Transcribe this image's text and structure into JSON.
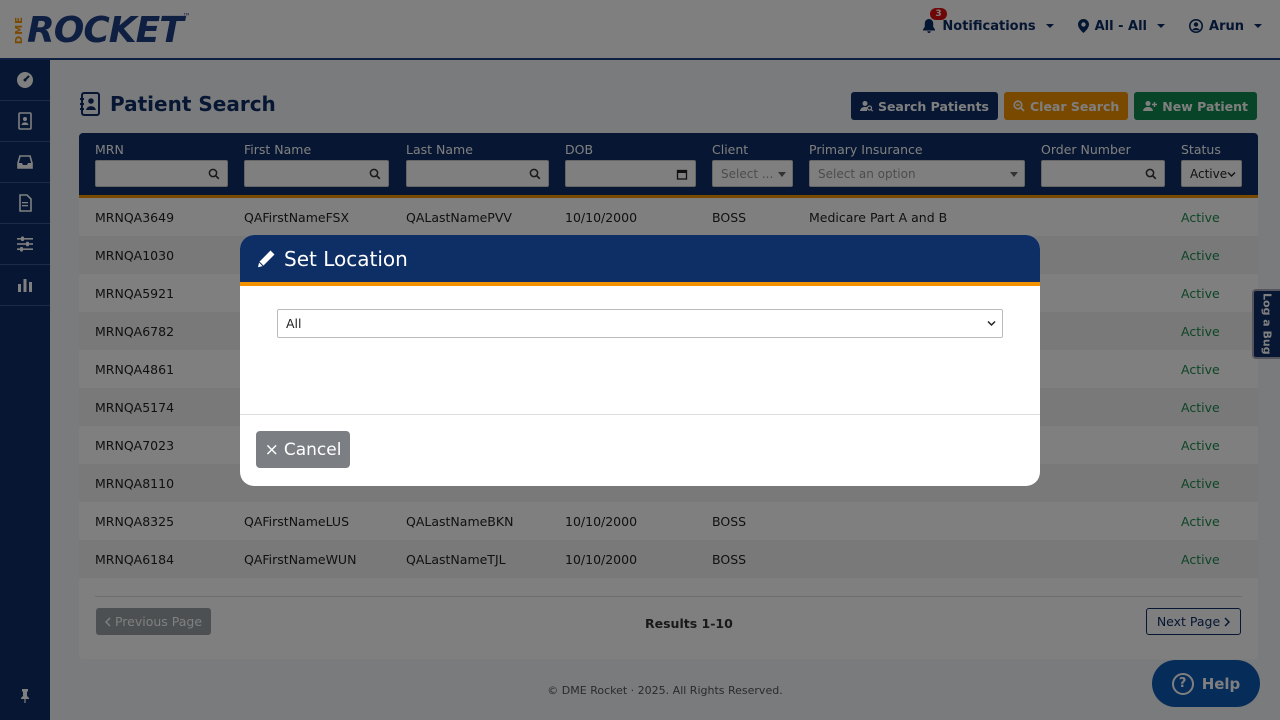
{
  "brand": {
    "prefix": "DME",
    "name": "ROCKET",
    "tm": "™"
  },
  "topnav": {
    "notifications_label": "Notifications",
    "notifications_count": "3",
    "location_label": "All - All",
    "user_label": "Arun"
  },
  "sidebar": {
    "items": [
      "dashboard-icon",
      "patients-icon",
      "inbox-icon",
      "documents-icon",
      "settings-sliders-icon",
      "reports-chart-icon"
    ]
  },
  "page": {
    "title": "Patient Search",
    "buttons": {
      "search": "Search Patients",
      "clear": "Clear Search",
      "new": "New Patient"
    }
  },
  "table": {
    "headers": [
      "MRN",
      "First Name",
      "Last Name",
      "DOB",
      "Client",
      "Primary Insurance",
      "Order Number",
      "Status"
    ],
    "filters": {
      "client_placeholder": "Select ...",
      "insurance_placeholder": "Select an option",
      "status_value": "Active"
    },
    "rows": [
      {
        "mrn": "MRNQA3649",
        "first": "QAFirstNameFSX",
        "last": "QALastNamePVV",
        "dob": "10/10/2000",
        "client": "BOSS",
        "insurance": "Medicare Part A and B",
        "status": "Active"
      },
      {
        "mrn": "MRNQA1030",
        "first": "",
        "last": "",
        "dob": "",
        "client": "",
        "insurance": "",
        "status": "Active"
      },
      {
        "mrn": "MRNQA5921",
        "first": "",
        "last": "",
        "dob": "",
        "client": "",
        "insurance": "",
        "status": "Active"
      },
      {
        "mrn": "MRNQA6782",
        "first": "",
        "last": "",
        "dob": "",
        "client": "",
        "insurance": "",
        "status": "Active"
      },
      {
        "mrn": "MRNQA4861",
        "first": "",
        "last": "",
        "dob": "",
        "client": "",
        "insurance": "",
        "status": "Active"
      },
      {
        "mrn": "MRNQA5174",
        "first": "",
        "last": "",
        "dob": "",
        "client": "",
        "insurance": "",
        "status": "Active"
      },
      {
        "mrn": "MRNQA7023",
        "first": "",
        "last": "",
        "dob": "",
        "client": "",
        "insurance": "",
        "status": "Active"
      },
      {
        "mrn": "MRNQA8110",
        "first": "",
        "last": "",
        "dob": "",
        "client": "",
        "insurance": "",
        "status": "Active"
      },
      {
        "mrn": "MRNQA8325",
        "first": "QAFirstNameLUS",
        "last": "QALastNameBKN",
        "dob": "10/10/2000",
        "client": "BOSS",
        "insurance": "",
        "status": "Active"
      },
      {
        "mrn": "MRNQA6184",
        "first": "QAFirstNameWUN",
        "last": "QALastNameTJL",
        "dob": "10/10/2000",
        "client": "BOSS",
        "insurance": "",
        "status": "Active"
      }
    ]
  },
  "pager": {
    "prev": "Previous Page",
    "results": "Results 1-10",
    "next": "Next Page"
  },
  "footer": "© DME Rocket  ·  2025. All Rights Reserved.",
  "log_bug": "Log a Bug",
  "help": "Help",
  "modal": {
    "title": "Set Location",
    "select_value": "All",
    "cancel": "Cancel"
  }
}
